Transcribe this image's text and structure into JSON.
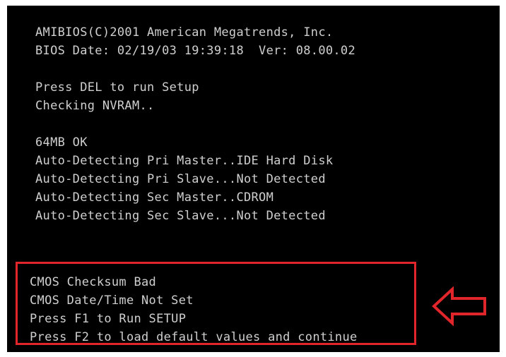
{
  "bios": {
    "header": [
      "AMIBIOS(C)2001 American Megatrends, Inc.",
      "BIOS Date: 02/19/03 19:39:18  Ver: 08.00.02"
    ],
    "setup": [
      "Press DEL to run Setup",
      "Checking NVRAM.."
    ],
    "detection": [
      "64MB OK",
      "Auto-Detecting Pri Master..IDE Hard Disk",
      "Auto-Detecting Pri Slave...Not Detected",
      "Auto-Detecting Sec Master..CDROM",
      "Auto-Detecting Sec Slave...Not Detected"
    ],
    "errors": [
      "CMOS Checksum Bad",
      "CMOS Date/Time Not Set",
      "Press F1 to Run SETUP",
      "Press F2 to load default values and continue"
    ]
  },
  "colors": {
    "screen_background": "#000000",
    "text": "#cfcfcf",
    "highlight": "#e0262b"
  },
  "icons": {
    "pointer": "left-arrow-icon"
  }
}
